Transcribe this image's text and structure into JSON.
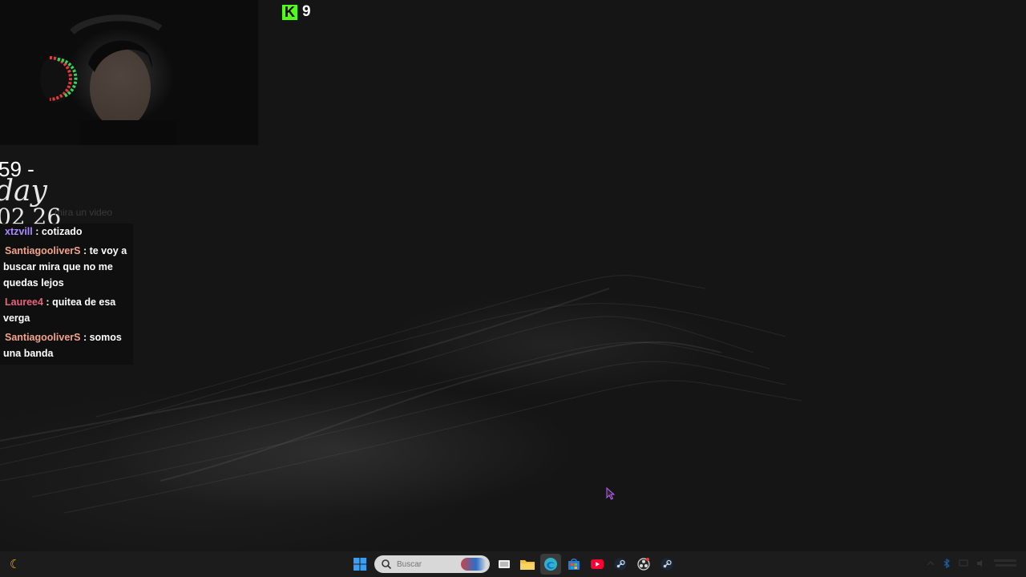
{
  "overlay": {
    "kick_count": "9",
    "clock": {
      "time_partial": "59 -",
      "day_partial": "day",
      "date_partial": "02 26",
      "hint": "mira un video"
    }
  },
  "chat": {
    "messages": [
      {
        "user": "xtzvill",
        "user_color": "#a98cff",
        "separator": " : ",
        "text": "cotizado"
      },
      {
        "user": "SantiagooliverS",
        "user_color": "#f2a38a",
        "separator": " : ",
        "text": "te voy a buscar mira que no me quedas lejos"
      },
      {
        "user": "Lauree4",
        "user_color": "#e8647e",
        "separator": " : ",
        "text": "quitea de esa verga"
      },
      {
        "user": "SantiagooliverS",
        "user_color": "#f2a38a",
        "separator": " : ",
        "text": "somos una banda"
      }
    ]
  },
  "taskbar": {
    "search_placeholder": "Buscar",
    "icons": [
      "windows-start-icon",
      "search-icon",
      "task-view-icon",
      "file-explorer-icon",
      "edge-browser-icon",
      "microsoft-store-icon",
      "youtube-icon",
      "steam-icon",
      "obs-icon",
      "steam-icon-2"
    ],
    "accent_colors": {
      "windows": "#3a9ef5",
      "folder": "#f5c33b",
      "edge": "#2fb3c9",
      "youtube": "#ff0033",
      "kick": "#53fc18"
    }
  }
}
